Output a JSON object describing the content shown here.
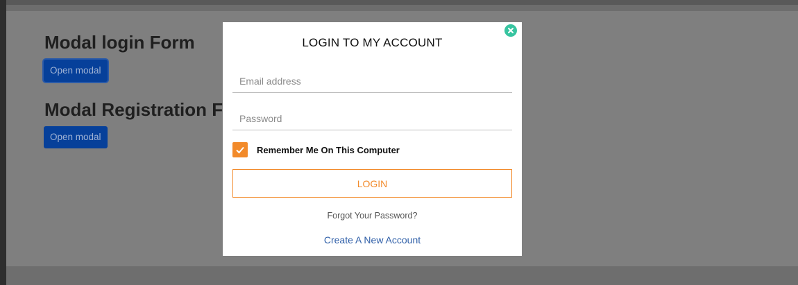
{
  "page": {
    "heading_login": "Modal login Form",
    "heading_registration": "Modal Registration Form",
    "open_modal_label": "Open modal"
  },
  "modal": {
    "title": "LOGIN TO MY ACCOUNT",
    "email_placeholder": "Email address",
    "password_placeholder": "Password",
    "remember_label": "Remember Me On This Computer",
    "remember_checked": true,
    "login_label": "LOGIN",
    "forgot_label": "Forgot Your Password?",
    "create_label": "Create A New Account"
  },
  "colors": {
    "accent": "#f28a2a",
    "close": "#37c4a0",
    "link": "#2f5fa8",
    "button": "#06409a"
  }
}
